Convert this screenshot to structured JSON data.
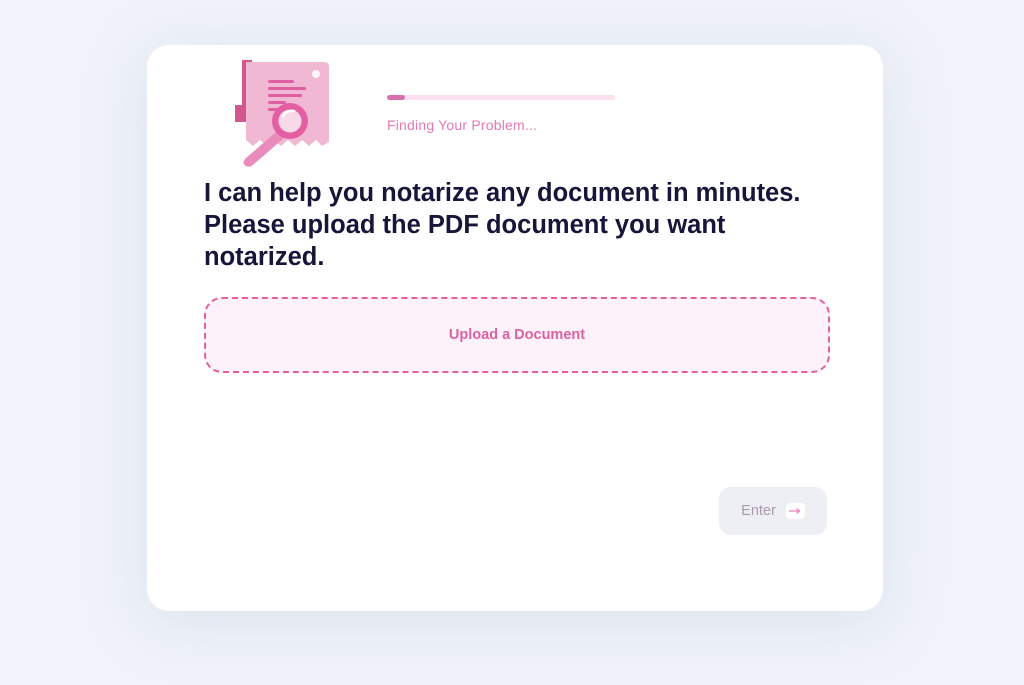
{
  "progress": {
    "label": "Finding Your Problem...",
    "fraction": 0.08,
    "color": "#d96fab"
  },
  "prompt": {
    "text": "I can help you notarize any document in minutes. Please upload the PDF document you want notarized."
  },
  "upload": {
    "label": "Upload a Document"
  },
  "enter": {
    "label": "Enter",
    "icon": "arrow-right-icon"
  },
  "illustration": {
    "icon": "document-magnifier-icon"
  },
  "colors": {
    "accent": "#e2609f",
    "heading": "#17163a",
    "background": "#f0f3f9"
  }
}
